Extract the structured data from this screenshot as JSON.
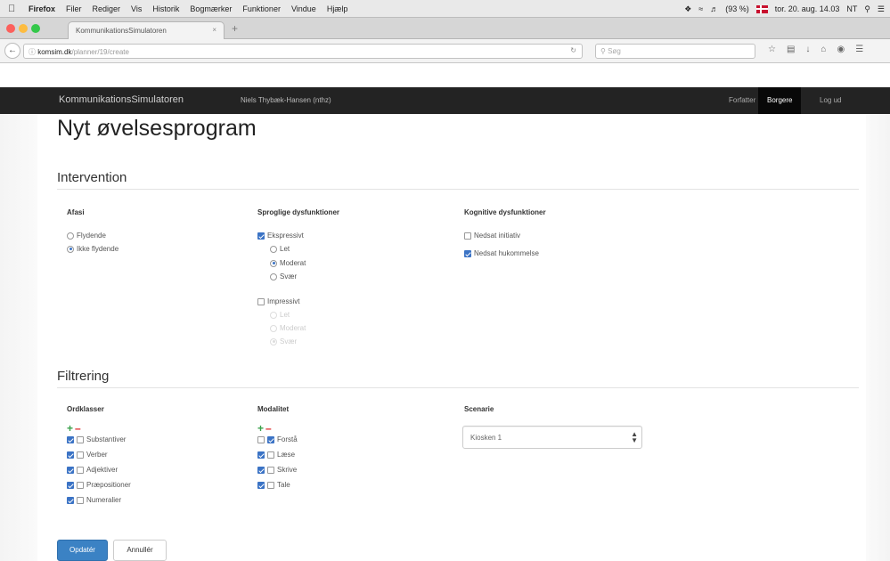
{
  "os_menubar": {
    "apple_icon": "apple-icon",
    "app_name": "Firefox",
    "items": [
      "Filer",
      "Rediger",
      "Vis",
      "Historik",
      "Bogmærker",
      "Funktioner",
      "Vindue",
      "Hjælp"
    ],
    "battery": "(93 %)",
    "datetime": "tor. 20. aug. 14.03",
    "user": "NT"
  },
  "browser": {
    "tab_title": "KommunikationsSimulatoren",
    "url_host": "komsim.dk",
    "url_path": "/planner/19/create",
    "search_placeholder": "Søg"
  },
  "app": {
    "brand": "KommunikationsSimulatoren",
    "user": "Niels Thybæk-Hansen (nthz)",
    "nav": [
      "Forfatter",
      "Borgere",
      "Log ud"
    ],
    "active_nav": "Borgere"
  },
  "page": {
    "title": "Nyt øvelsesprogram"
  },
  "intervention": {
    "title": "Intervention",
    "afasi": {
      "label": "Afasi",
      "options": [
        "Flydende",
        "Ikke flydende"
      ],
      "selected": "Ikke flydende"
    },
    "sprog": {
      "label": "Sproglige dysfunktioner",
      "ekspressivt": "Ekspressivt",
      "ekspressivt_checked": true,
      "ekspressivt_levels": [
        "Let",
        "Moderat",
        "Svær"
      ],
      "ekspressivt_selected": "Moderat",
      "impressivt": "Impressivt",
      "impressivt_checked": false,
      "impressivt_levels": [
        "Let",
        "Moderat",
        "Svær"
      ],
      "impressivt_selected": "Svær"
    },
    "kognitive": {
      "label": "Kognitive dysfunktioner",
      "options": [
        "Nedsat initiativ",
        "Nedsat hukommelse"
      ],
      "checked": [
        false,
        true
      ]
    }
  },
  "filtrering": {
    "title": "Filtrering",
    "ordklasser": {
      "label": "Ordklasser",
      "items": [
        "Substantiver",
        "Verber",
        "Adjektiver",
        "Præpositioner",
        "Numeralier"
      ]
    },
    "modalitet": {
      "label": "Modalitet",
      "items": [
        "Forstå",
        "Læse",
        "Skrive",
        "Tale"
      ],
      "second_checked": [
        true,
        false,
        false,
        false
      ]
    },
    "scenarie": {
      "label": "Scenarie",
      "selected": "Kiosken 1"
    }
  },
  "actions": {
    "update": "Opdatér",
    "cancel": "Annullér"
  },
  "colors": {
    "navbar_bg": "#232323",
    "primary": "#3b82c4",
    "plus": "#3aa14b",
    "minus": "#dd2222"
  }
}
